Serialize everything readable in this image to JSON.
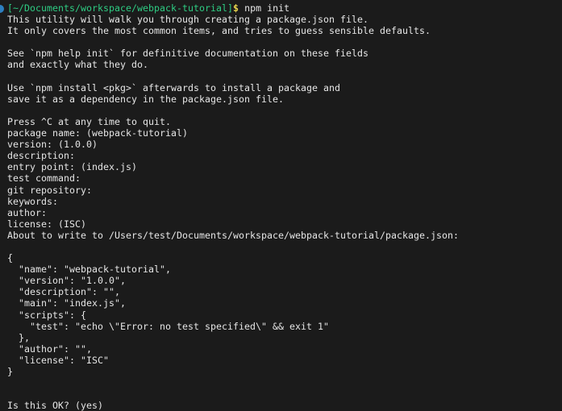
{
  "terminal": {
    "background_color": "#1b1b1b",
    "foreground_color": "#e6e6e6",
    "prompt": {
      "indicator_icon": "prompt-indicator-dot",
      "indicator_color": "#2d7fc1",
      "open_bracket": "[",
      "path": "~/Documents/workspace/webpack-tutorial",
      "close_bracket": "]",
      "path_color": "#2ecc83",
      "symbol": "$",
      "symbol_color": "#e8d44d",
      "command": " npm init"
    },
    "output_lines": [
      "This utility will walk you through creating a package.json file.",
      "It only covers the most common items, and tries to guess sensible defaults.",
      "",
      "See `npm help init` for definitive documentation on these fields",
      "and exactly what they do.",
      "",
      "Use `npm install <pkg>` afterwards to install a package and",
      "save it as a dependency in the package.json file.",
      "",
      "Press ^C at any time to quit.",
      "package name: (webpack-tutorial)",
      "version: (1.0.0)",
      "description:",
      "entry point: (index.js)",
      "test command:",
      "git repository:",
      "keywords:",
      "author:",
      "license: (ISC)",
      "About to write to /Users/test/Documents/workspace/webpack-tutorial/package.json:",
      "",
      "{",
      "  \"name\": \"webpack-tutorial\",",
      "  \"version\": \"1.0.0\",",
      "  \"description\": \"\",",
      "  \"main\": \"index.js\",",
      "  \"scripts\": {",
      "    \"test\": \"echo \\\"Error: no test specified\\\" && exit 1\"",
      "  },",
      "  \"author\": \"\",",
      "  \"license\": \"ISC\"",
      "}",
      "",
      "",
      "Is this OK? (yes)"
    ]
  }
}
